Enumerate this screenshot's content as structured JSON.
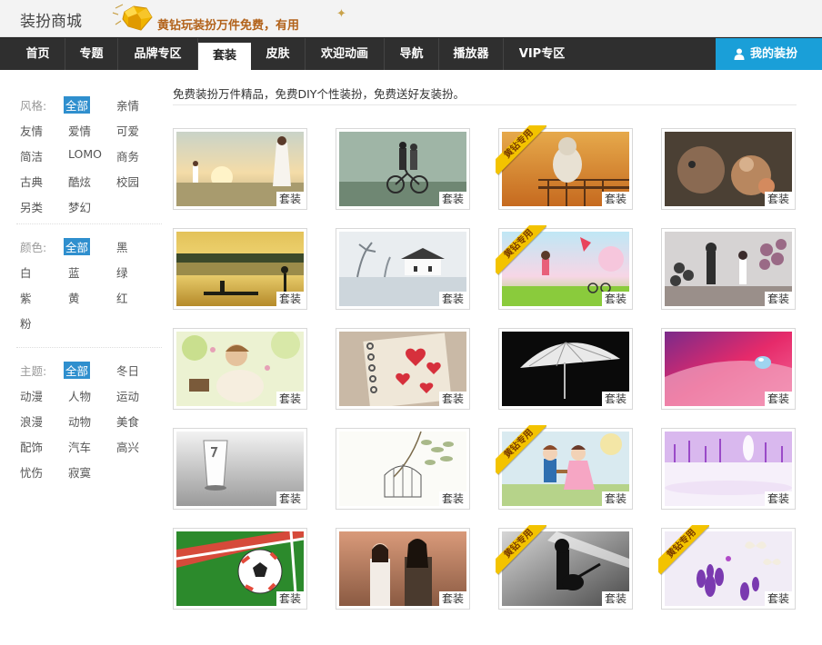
{
  "header": {
    "title": "装扮商城",
    "promo_text": "黄钻玩装扮万件免费，有用",
    "icons": {
      "promo": "diamond-icon",
      "sparkle": "sparkle-icon"
    },
    "colors": {
      "promo_text": "#b2621a",
      "diamond": "#f0b400"
    }
  },
  "nav": {
    "items": [
      {
        "label": "首页"
      },
      {
        "label": "专题"
      },
      {
        "label": "品牌专区"
      },
      {
        "label": "套装",
        "active": true
      },
      {
        "label": "皮肤"
      },
      {
        "label": "欢迎动画"
      },
      {
        "label": "导航"
      },
      {
        "label": "播放器"
      },
      {
        "label": "VIP专区"
      }
    ],
    "mine_label": "我的装扮",
    "mine_icon": "user-icon",
    "colors": {
      "bar": "#2f2f2f",
      "mine": "#1a9fd8"
    }
  },
  "filters": {
    "style": {
      "label": "风格:",
      "options": [
        "全部",
        "亲情",
        "友情",
        "爱情",
        "可爱",
        "简洁",
        "LOMO",
        "商务",
        "古典",
        "酷炫",
        "校园",
        "另类",
        "梦幻"
      ],
      "selected": "全部"
    },
    "color": {
      "label": "颜色:",
      "options": [
        "全部",
        "黑",
        "白",
        "蓝",
        "绿",
        "紫",
        "黄",
        "红",
        "粉"
      ],
      "selected": "全部"
    },
    "theme": {
      "label": "主题:",
      "options": [
        "全部",
        "冬日",
        "动漫",
        "人物",
        "运动",
        "浪漫",
        "动物",
        "美食",
        "配饰",
        "汽车",
        "高兴",
        "忧伤",
        "寂寞"
      ],
      "selected": "全部"
    },
    "selected_color": "#2f8fce"
  },
  "main": {
    "intro": "免费装扮万件精品，免费DIY个性装扮，免费送好友装扮。",
    "tag_label": "套装",
    "ribbon_label": "黄钻专用",
    "items": [
      {
        "scene": "sunset-couple",
        "vip": false
      },
      {
        "scene": "bicycle-couple",
        "vip": false
      },
      {
        "scene": "cat-balcony",
        "vip": true
      },
      {
        "scene": "plush-bears",
        "vip": false
      },
      {
        "scene": "lake-boat",
        "vip": false
      },
      {
        "scene": "winter-village",
        "vip": false
      },
      {
        "scene": "girl-kite",
        "vip": true
      },
      {
        "scene": "balloons-couple",
        "vip": false
      },
      {
        "scene": "girl-flowers",
        "vip": false
      },
      {
        "scene": "hearts-notebook",
        "vip": false
      },
      {
        "scene": "umbrella-bw",
        "vip": false
      },
      {
        "scene": "water-drop",
        "vip": false
      },
      {
        "scene": "glass-cup",
        "vip": false
      },
      {
        "scene": "birdcage-branch",
        "vip": false
      },
      {
        "scene": "anime-couple",
        "vip": true
      },
      {
        "scene": "purple-lavender",
        "vip": false
      },
      {
        "scene": "soccer-ball",
        "vip": false
      },
      {
        "scene": "drama-couple",
        "vip": false
      },
      {
        "scene": "guitar-silhouette",
        "vip": true
      },
      {
        "scene": "butterflies-flowers",
        "vip": true
      }
    ]
  }
}
